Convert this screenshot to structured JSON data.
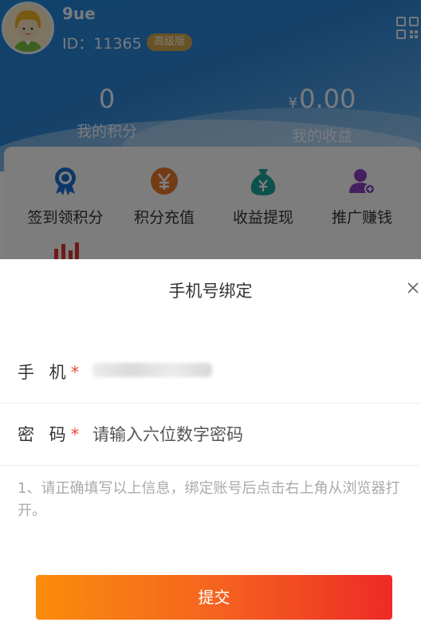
{
  "profile": {
    "username": "9ue",
    "id_text": "ID：11365",
    "badge": "高级版"
  },
  "stats": {
    "points_value": "0",
    "points_label": "我的积分",
    "income_currency": "¥",
    "income_value": "0.00",
    "income_label": "我的收益"
  },
  "menu": [
    {
      "label": "签到领积分",
      "icon": "medal-icon",
      "color": "#1a6fcf"
    },
    {
      "label": "积分充值",
      "icon": "yen-coin-icon",
      "color": "#e8782a"
    },
    {
      "label": "收益提现",
      "icon": "money-bag-icon",
      "color": "#1aa39a"
    },
    {
      "label": "推广赚钱",
      "icon": "add-user-icon",
      "color": "#8a3fc0"
    }
  ],
  "modal": {
    "title": "手机号绑定",
    "phone_label": "手 机",
    "password_label": "密 码",
    "required_mark": "*",
    "password_placeholder": "请输入六位数字密码",
    "notice": "1、请正确填写以上信息，绑定账号后点击右上角从浏览器打开。",
    "submit_label": "提交"
  },
  "colors": {
    "header": "#2d84d4",
    "submit_start": "#fa8c0c",
    "submit_end": "#ee2b25",
    "required": "#e74c3c"
  }
}
